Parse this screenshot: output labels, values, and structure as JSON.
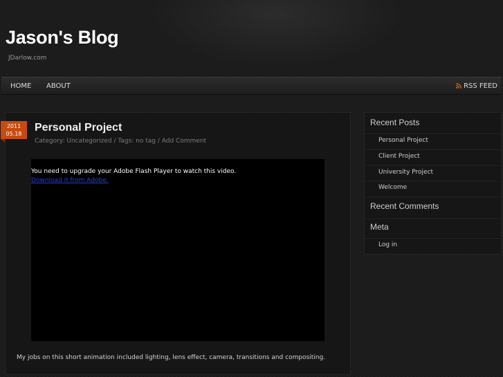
{
  "header": {
    "site_title": "Jason's Blog",
    "site_description": "JDarlow.com"
  },
  "nav": {
    "items": [
      {
        "label": "HOME"
      },
      {
        "label": "ABOUT"
      }
    ],
    "rss_label": "RSS FEED",
    "rss_icon": "rss-icon"
  },
  "post": {
    "date_year": "2011",
    "date_day": "05.18",
    "title": "Personal Project",
    "category_prefix": "Category: ",
    "category": "Uncategorized",
    "tags_prefix": " / Tags: ",
    "tags": "no tag",
    "sep": " / ",
    "comment_link": "Add Comment",
    "flash_message": "You need to upgrade your Adobe Flash Player to watch this video.",
    "flash_link": "Download it from Adobe.",
    "body": "My jobs on this short animation included lighting, lens effect, camera, transitions and compositing."
  },
  "sidebar": {
    "recent_posts_title": "Recent Posts",
    "recent_posts": [
      {
        "label": "Personal Project"
      },
      {
        "label": "Client Project"
      },
      {
        "label": "University Project"
      },
      {
        "label": "Welcome"
      }
    ],
    "recent_comments_title": "Recent Comments",
    "meta_title": "Meta",
    "meta_items": [
      {
        "label": "Log in"
      }
    ]
  },
  "colors": {
    "accent": "#c84a10",
    "background": "#1b1b1b",
    "link": "#2b3fd6",
    "rss": "#e07a1f"
  }
}
